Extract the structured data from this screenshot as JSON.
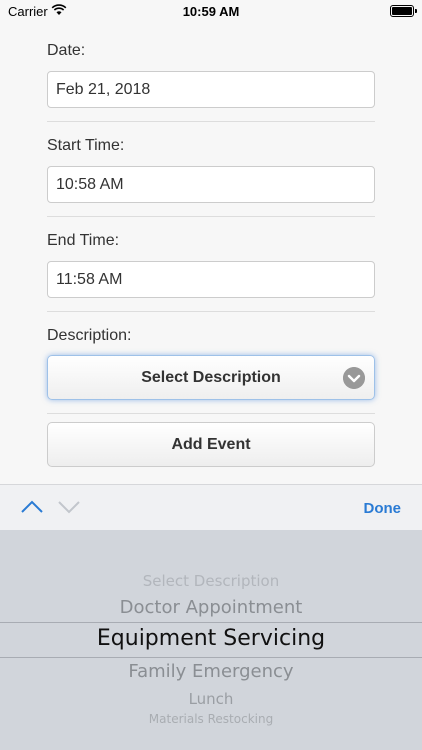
{
  "status_bar": {
    "carrier": "Carrier",
    "time": "10:59 AM"
  },
  "form": {
    "date_label": "Date:",
    "date_value": "Feb 21, 2018",
    "start_label": "Start Time:",
    "start_value": "10:58 AM",
    "end_label": "End Time:",
    "end_value": "11:58 AM",
    "description_label": "Description:",
    "select_label": "Select Description",
    "add_label": "Add Event"
  },
  "toolbar": {
    "done_label": "Done"
  },
  "picker": {
    "options": [
      "Select Description",
      "Doctor Appointment",
      "Equipment Servicing",
      "Family Emergency",
      "Lunch",
      "Materials Restocking"
    ],
    "selected": "Equipment Servicing"
  },
  "colors": {
    "accent": "#2a7bd4",
    "picker_bg": "#d1d5db"
  }
}
